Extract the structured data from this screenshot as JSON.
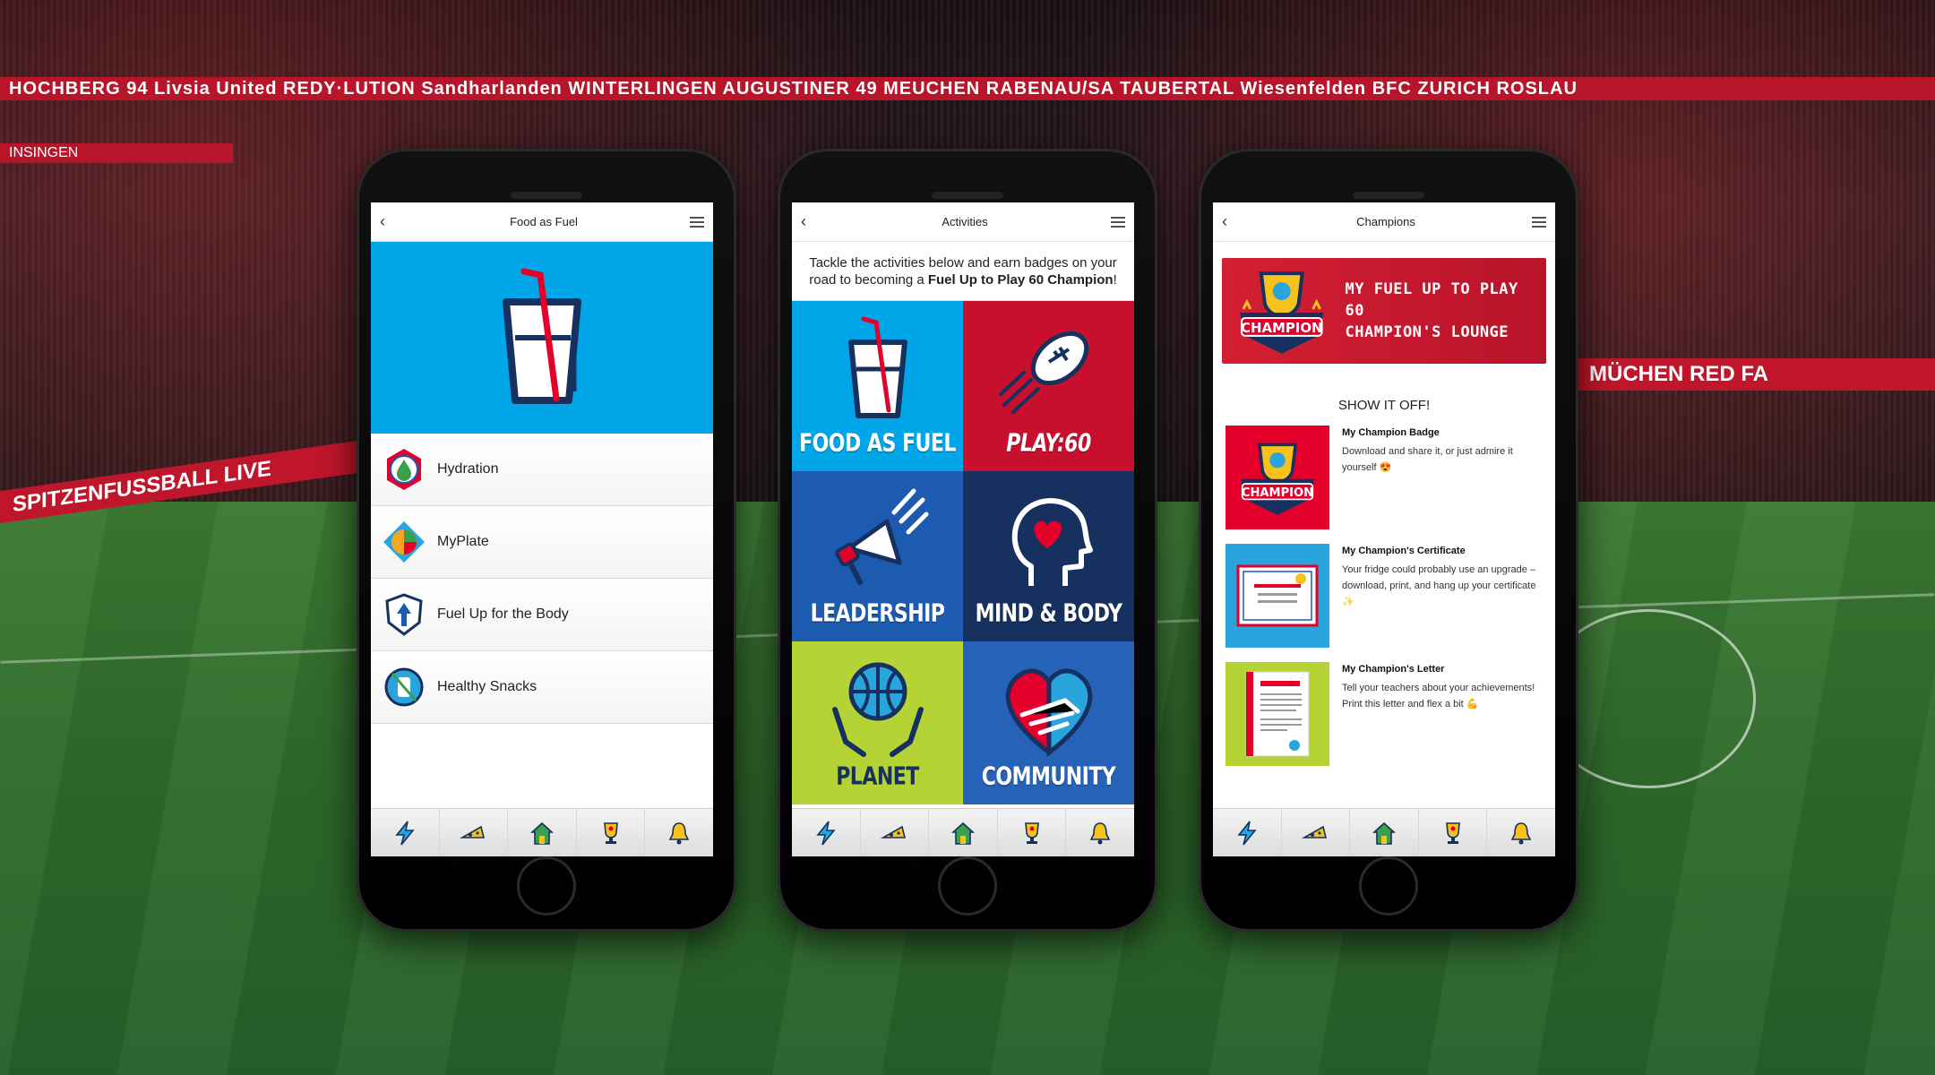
{
  "background": {
    "banner_text": "HOCHBERG 94  Livsia United   REDY·LUTION  Sandharlanden  WINTERLINGEN  AUGUSTINER 49  MEUCHEN  RABENAU/SA  TAUBERTAL  Wiesenfelden  BFC ZURICH  ROSLAU",
    "side_banner": "INSINGEN",
    "ad_left": "SPITZENFUSSBALL LIVE",
    "ad_right": "MÜCHEN   RED FA"
  },
  "phones": [
    {
      "title": "Food as Fuel",
      "items": [
        {
          "label": "Hydration",
          "color": "#1f8fd6"
        },
        {
          "label": "MyPlate",
          "color": "#3aa14a"
        },
        {
          "label": "Fuel Up for the Body",
          "color": "#1d5bb0"
        },
        {
          "label": "Healthy Snacks",
          "color": "#29a4dd"
        }
      ]
    },
    {
      "title": "Activities",
      "intro_plain": "Tackle the activities below and earn badges on your road to becoming a ",
      "intro_bold": "Fuel Up to Play 60 Champion",
      "intro_end": "!",
      "tiles": [
        {
          "label": "FOOD AS FUEL",
          "icon": "cup-icon"
        },
        {
          "label": "PLAY:60",
          "icon": "football-icon"
        },
        {
          "label": "LEADERSHIP",
          "icon": "megaphone-icon"
        },
        {
          "label": "MIND & BODY",
          "icon": "head-heart-icon"
        },
        {
          "label": "PLANET",
          "icon": "globe-hands-icon"
        },
        {
          "label": "COMMUNITY",
          "icon": "heart-handshake-icon"
        }
      ]
    },
    {
      "title": "Champions",
      "lounge_line1": "MY FUEL UP TO PLAY 60",
      "lounge_line2": "CHAMPION'S LOUNGE",
      "badge_word": "CHAMPION",
      "section": "SHOW IT OFF!",
      "items": [
        {
          "title": "My Champion Badge",
          "desc": "Download and share it, or just admire it yourself 😍"
        },
        {
          "title": "My Champion's Certificate",
          "desc": "Your fridge could probably use an upgrade – download, print, and hang up your certificate ✨"
        },
        {
          "title": "My Champion's Letter",
          "desc": "Tell your teachers about your achievements! Print this letter and flex a bit 💪"
        }
      ]
    }
  ],
  "tabbar": [
    "lightning-icon",
    "cheese-icon",
    "home-icon",
    "trophy-icon",
    "bell-icon"
  ],
  "colors": {
    "blue": "#00a6e8",
    "red": "#c8102e",
    "navy": "#16305f",
    "lime": "#b5d334"
  }
}
